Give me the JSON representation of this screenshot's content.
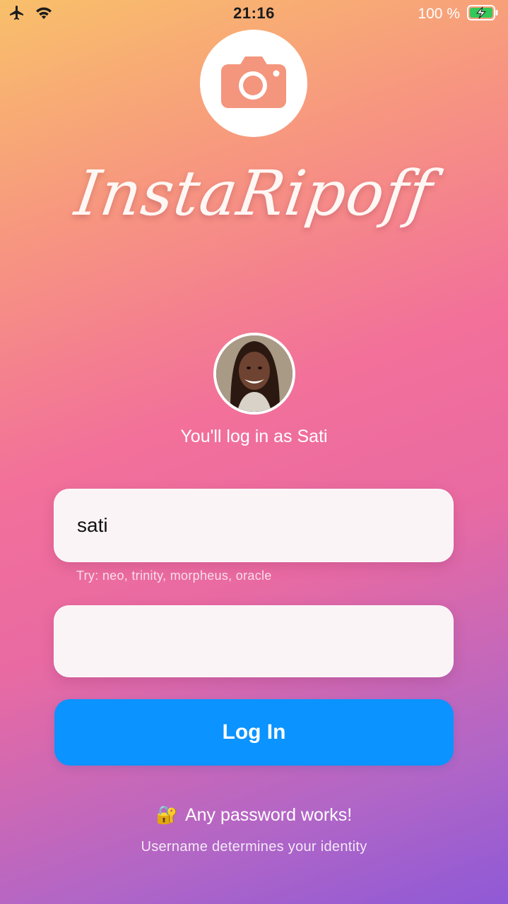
{
  "status_bar": {
    "time": "21:16",
    "battery_percent": "100 %",
    "icons": [
      "airplane-icon",
      "wifi-icon",
      "battery-charging-icon"
    ]
  },
  "app": {
    "title": "InstaRipoff",
    "logo_icon": "camera-icon"
  },
  "profile": {
    "login_as_text": "You'll log in as Sati"
  },
  "form": {
    "username_value": "sati",
    "username_hint": "Try: neo, trinity, morpheus, oracle",
    "password_value": "",
    "login_label": "Log In"
  },
  "footer": {
    "primary_emoji": "🔐",
    "primary_text": "Any password works!",
    "secondary_text": "Username determines your identity"
  },
  "colors": {
    "accent_button": "#0b93ff",
    "logo_camera": "#f4957d"
  }
}
